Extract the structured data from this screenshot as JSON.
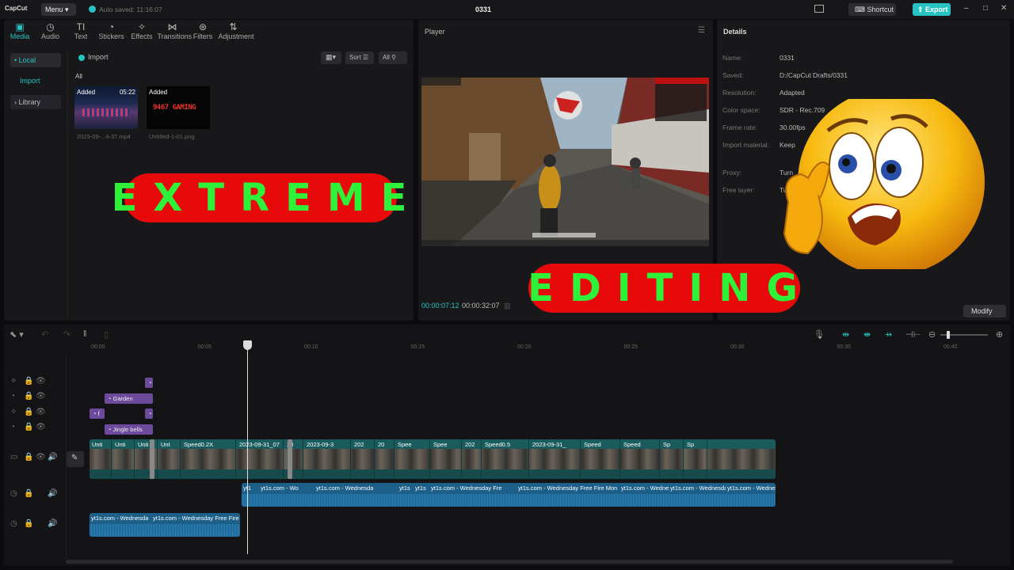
{
  "titlebar": {
    "logo": "CapCut",
    "menu": "Menu",
    "autosave": "Auto saved: 11:16:07",
    "project": "0331",
    "shortcut": "Shortcut",
    "export": "Export",
    "window_controls": [
      "–",
      "□",
      "✕"
    ]
  },
  "toolbar": {
    "tools": [
      {
        "label": "Media",
        "icon": "media-icon",
        "glyph": "▣",
        "active": true
      },
      {
        "label": "Audio",
        "icon": "audio-icon",
        "glyph": "◷"
      },
      {
        "label": "Text",
        "icon": "text-icon",
        "glyph": "TI"
      },
      {
        "label": "Stickers",
        "icon": "sticker-icon",
        "glyph": "◔"
      },
      {
        "label": "Effects",
        "icon": "effects-icon",
        "glyph": "✧"
      },
      {
        "label": "Transitions",
        "icon": "transitions-icon",
        "glyph": "⋈"
      },
      {
        "label": "Filters",
        "icon": "filters-icon",
        "glyph": "⊛"
      },
      {
        "label": "Adjustment",
        "icon": "adjustment-icon",
        "glyph": "⇅"
      }
    ]
  },
  "media": {
    "sidebar": {
      "local": "• Local",
      "import": "Import",
      "library": "› Library"
    },
    "import_button": "Import",
    "sort": "Sort",
    "filter": "All",
    "all_label": "All",
    "items": [
      {
        "badge": "Added",
        "duration": "05:22",
        "caption": "2023-09-...4-37.mp4"
      },
      {
        "badge": "Added",
        "caption": "Untitled-1-01.png",
        "thumb_text": "9467 GAMING"
      }
    ]
  },
  "player": {
    "title": "Player",
    "current_time": "00:00:07:12",
    "total_time": "00:00:32:07"
  },
  "details": {
    "title": "Details",
    "fields": [
      {
        "label": "Name:",
        "value": "0331"
      },
      {
        "label": "Saved:",
        "value": "D:/CapCut Drafts/0331"
      },
      {
        "label": "Resolution:",
        "value": "Adapted"
      },
      {
        "label": "Color space:",
        "value": "SDR - Rec.709"
      },
      {
        "label": "Frame rate:",
        "value": "30.00fps"
      },
      {
        "label": "Import material:",
        "value": "Keep"
      },
      {
        "label": "Proxy:",
        "value": "Turn"
      },
      {
        "label": "Free layer:",
        "value": "Turn"
      }
    ],
    "modify": "Modify"
  },
  "overlay": {
    "word1": "EXTREME",
    "word2": "EDITING",
    "pill_color": "#e80a0a",
    "text_color": "#2ef23a"
  },
  "timeline": {
    "ticks": [
      "00:00",
      "00:05",
      "00:10",
      "00:15",
      "00:20",
      "00:25",
      "00:30",
      "00:35",
      "00:40"
    ],
    "stickers": [
      {
        "label": "Garden"
      },
      {
        "label": "Jingle bells"
      }
    ],
    "main_clips": [
      "Unti",
      "Unti",
      "Unti",
      "Unt",
      "Speed0.2X",
      "2023-09-31_07",
      "20",
      "2023-09-3",
      "202",
      "20",
      "Spee",
      "Spee",
      "202",
      "Speed0.5",
      "2023-09-31_",
      "Speed",
      "Speed",
      "Sp",
      "Sp"
    ],
    "audio1": [
      "yt1",
      "yt1s.com - Wo",
      "yt1s.com - Wednesda",
      "yt1s",
      "yt1s",
      "yt1s.com - Wednesday Fre",
      "yt1s.com - Wednesday Free Fire Mon",
      "yt1s.com - Wedne",
      "yt1s.com - Wednesday",
      "yt1s.com - Wednesday"
    ],
    "audio2": [
      "yt1s.com - Wednesda",
      "yt1s.com - Wednesday Free Fire"
    ]
  },
  "colors": {
    "accent": "#27c3c3",
    "video_track": "#1a5c5e",
    "audio_track": "#1c5f88",
    "sticker": "#6d4a9b"
  }
}
